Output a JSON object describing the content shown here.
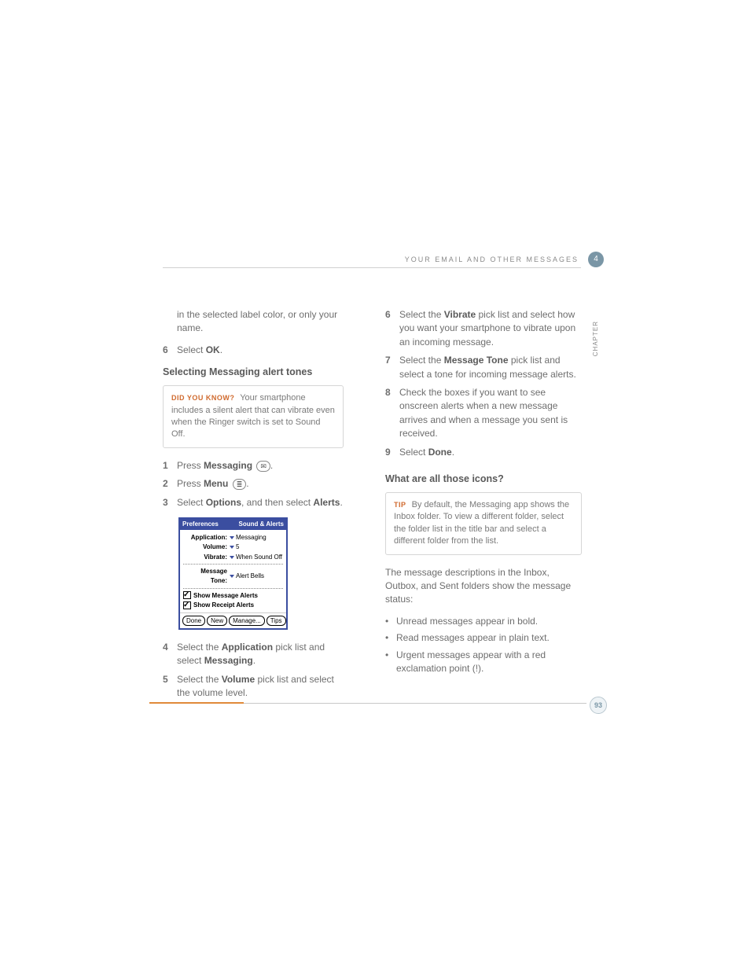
{
  "header": {
    "running_head": "YOUR EMAIL AND OTHER MESSAGES",
    "chapter_num": "4",
    "chapter_label": "CHAPTER"
  },
  "left": {
    "carryover": "in the selected label color, or only your name.",
    "step6_num": "6",
    "step6_a": "Select ",
    "step6_b": "OK",
    "step6_c": ".",
    "h1": "Selecting Messaging alert tones",
    "dyk_tag": "DID YOU KNOW?",
    "dyk_body": " Your smartphone includes a silent alert that can vibrate even when the Ringer switch is set to Sound Off.",
    "s1_num": "1",
    "s1_a": "Press ",
    "s1_b": "Messaging",
    "s1_icon": "✉",
    "s1_c": ".",
    "s2_num": "2",
    "s2_a": "Press ",
    "s2_b": "Menu",
    "s2_icon": "≣",
    "s2_c": ".",
    "s3_num": "3",
    "s3_a": "Select ",
    "s3_b": "Options",
    "s3_c": ", and then select ",
    "s3_d": "Alerts",
    "s3_e": ".",
    "palm": {
      "title_left": "Preferences",
      "title_right": "Sound & Alerts",
      "app_lab": "Application:",
      "app_val": "Messaging",
      "vol_lab": "Volume:",
      "vol_val": "5",
      "vib_lab": "Vibrate:",
      "vib_val": "When Sound Off",
      "mt_lab": "Message Tone:",
      "mt_val": "Alert Bells",
      "chk1": "Show Message Alerts",
      "chk2": "Show Receipt Alerts",
      "btn_done": "Done",
      "btn_new": "New",
      "btn_manage": "Manage...",
      "btn_tips": "Tips"
    },
    "s4_num": "4",
    "s4_a": "Select the ",
    "s4_b": "Application",
    "s4_c": " pick list and select ",
    "s4_d": "Messaging",
    "s4_e": ".",
    "s5_num": "5",
    "s5_a": "Select the ",
    "s5_b": "Volume",
    "s5_c": " pick list and select the volume level."
  },
  "right": {
    "s6_num": "6",
    "s6_a": "Select the ",
    "s6_b": "Vibrate",
    "s6_c": " pick list and select how you want your smartphone to vibrate upon an incoming message.",
    "s7_num": "7",
    "s7_a": "Select the ",
    "s7_b": "Message Tone",
    "s7_c": " pick list and select a tone for incoming message alerts.",
    "s8_num": "8",
    "s8_a": "Check the boxes if you want to see onscreen alerts when a new message arrives and when a message you sent is received.",
    "s9_num": "9",
    "s9_a": "Select ",
    "s9_b": "Done",
    "s9_c": ".",
    "h2": "What are all those icons?",
    "tip_tag": "TIP",
    "tip_body": " By default, the Messaging app shows the Inbox folder. To view a different folder, select the folder list in the title bar and select a different folder from the list.",
    "para": "The message descriptions in the Inbox, Outbox, and Sent folders show the message status:",
    "b1": "Unread messages appear in bold.",
    "b2": "Read messages appear in plain text.",
    "b3": "Urgent messages appear with a red exclamation point (!)."
  },
  "footer": {
    "page": "93"
  }
}
